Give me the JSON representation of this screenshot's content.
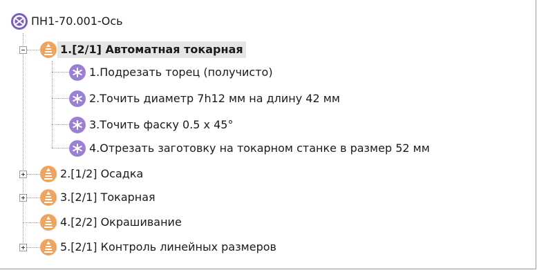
{
  "colors": {
    "root_icon": "#7a5cc4",
    "operation_icon": "#f0a35c",
    "step_icon": "#9b7fd6",
    "selection": "#e5e5e5",
    "connector": "#9c9c9c"
  },
  "tree": {
    "root": {
      "label": "ПН1-70.001-Ось",
      "icon": "part-icon"
    },
    "operations": [
      {
        "label": "1.[2/1] Автоматная токарная",
        "expanded": true,
        "selected": true,
        "icon": "turning-operation-icon",
        "steps": [
          {
            "label": "1.Подрезать торец (получисто)",
            "icon": "step-icon"
          },
          {
            "label": "2.Точить диаметр 7h12 мм на длину 42 мм",
            "icon": "step-icon"
          },
          {
            "label": "3.Точить фаску 0.5 х 45°",
            "icon": "step-icon"
          },
          {
            "label": "4.Отрезать заготовку на токарном станке в размер 52 мм",
            "icon": "step-icon"
          }
        ]
      },
      {
        "label": "2.[1/2] Осадка",
        "expanded": false,
        "has_children": true,
        "icon": "operation-icon"
      },
      {
        "label": "3.[2/1] Токарная",
        "expanded": false,
        "has_children": true,
        "icon": "operation-icon"
      },
      {
        "label": "4.[2/2] Окрашивание",
        "expanded": false,
        "has_children": false,
        "icon": "operation-icon"
      },
      {
        "label": "5.[2/1] Контроль линейных размеров",
        "expanded": false,
        "has_children": true,
        "icon": "operation-icon"
      }
    ]
  }
}
